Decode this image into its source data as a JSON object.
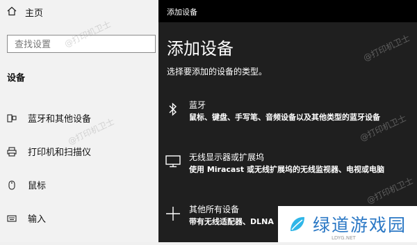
{
  "left": {
    "home": "主页",
    "search_placeholder": "查找设置",
    "section": "设备",
    "nav": [
      {
        "label": "蓝牙和其他设备",
        "icon": "bluetooth-devices-icon"
      },
      {
        "label": "打印机和扫描仪",
        "icon": "printer-icon"
      },
      {
        "label": "鼠标",
        "icon": "mouse-icon"
      },
      {
        "label": "输入",
        "icon": "keyboard-icon"
      }
    ]
  },
  "dialog": {
    "titlebar": "添加设备",
    "heading": "添加设备",
    "description": "选择要添加的设备的类型。",
    "options": [
      {
        "title": "蓝牙",
        "desc": "鼠标、键盘、手写笔、音频设备以及其他类型的蓝牙设备",
        "icon": "bluetooth-icon"
      },
      {
        "title": "无线显示器或扩展坞",
        "desc": "使用 Miracast 或无线扩展坞的无线监视器、电视或电脑",
        "icon": "monitor-icon"
      },
      {
        "title": "其他所有设备",
        "desc": "带有无线适配器、DLNA",
        "icon": "plus-icon"
      }
    ]
  },
  "watermark": "@打印机卫士",
  "logo": {
    "text": "绿道游戏园",
    "sub": "LDYG.NET"
  }
}
